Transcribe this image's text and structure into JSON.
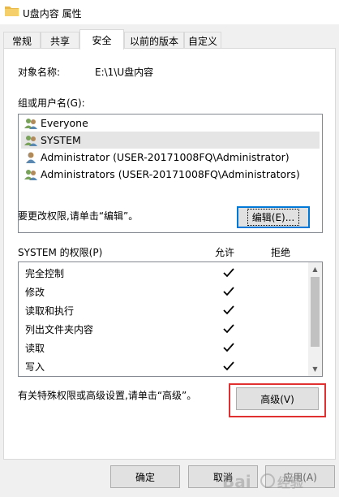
{
  "window": {
    "title": "U盘内容 属性"
  },
  "tabs": [
    {
      "label": "常规"
    },
    {
      "label": "共享"
    },
    {
      "label": "安全"
    },
    {
      "label": "以前的版本"
    },
    {
      "label": "自定义"
    }
  ],
  "object": {
    "label": "对象名称:",
    "value": "E:\\1\\U盘内容"
  },
  "groups": {
    "label": "组或用户名(G):",
    "items": [
      {
        "name": "Everyone",
        "icon": "group-icon"
      },
      {
        "name": "SYSTEM",
        "icon": "group-icon",
        "selected": true
      },
      {
        "name": "Administrator (USER-20171008FQ\\Administrator)",
        "icon": "user-icon"
      },
      {
        "name": "Administrators (USER-20171008FQ\\Administrators)",
        "icon": "group-icon"
      }
    ]
  },
  "edit": {
    "hint": "要更改权限,请单击“编辑”。",
    "button_label": "编辑(E)..."
  },
  "permissions": {
    "label": "SYSTEM 的权限(P)",
    "allow_header": "允许",
    "deny_header": "拒绝",
    "items": [
      {
        "name": "完全控制",
        "allow": true,
        "deny": false
      },
      {
        "name": "修改",
        "allow": true,
        "deny": false
      },
      {
        "name": "读取和执行",
        "allow": true,
        "deny": false
      },
      {
        "name": "列出文件夹内容",
        "allow": true,
        "deny": false
      },
      {
        "name": "读取",
        "allow": true,
        "deny": false
      },
      {
        "name": "写入",
        "allow": true,
        "deny": false
      }
    ]
  },
  "advanced": {
    "hint": "有关特殊权限或高级设置,请单击“高级”。",
    "button_label": "高级(V)"
  },
  "footer": {
    "ok_label": "确定",
    "cancel_label": "取消",
    "apply_label": "应用(A)"
  },
  "colors": {
    "highlight": "#e03030",
    "focus": "#0078d7"
  }
}
